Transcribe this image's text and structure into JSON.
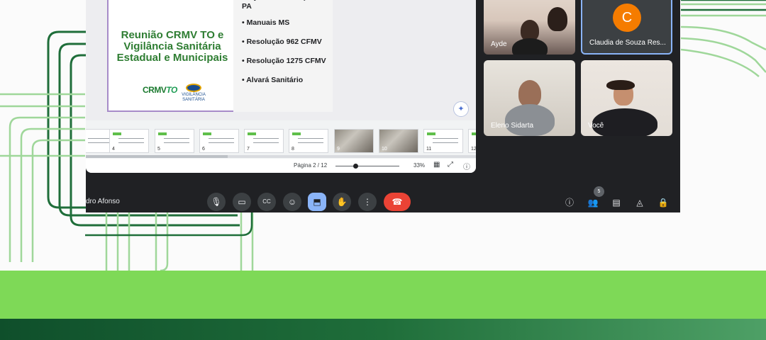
{
  "slide": {
    "title": "Reunião CRMV TO e Vigilância Sanitária Estadual e Municipais",
    "bullets": [
      "Projeto de castração CCZ PA",
      "• Manuais MS",
      "• Resolução 962 CFMV",
      "• Resolução 1275 CFMV",
      "• Alvará Sanitário"
    ],
    "logo_crmv": "CRMV",
    "logo_crmv_suffix": "TO",
    "logo_vigilancia": "VIGILÂNCIA SANITÁRIA"
  },
  "thumbnails": [
    {
      "num": "4"
    },
    {
      "num": "5"
    },
    {
      "num": "6"
    },
    {
      "num": "7"
    },
    {
      "num": "8"
    },
    {
      "num": "9"
    },
    {
      "num": "10"
    },
    {
      "num": "11"
    },
    {
      "num": "12"
    }
  ],
  "presentation_toolbar": {
    "page_indicator": "Página 2 / 12",
    "zoom_percent": "33%",
    "zoom_level": 0.33
  },
  "participants": {
    "ayde": "Ayde",
    "claudia": "Claudia de Souza Res...",
    "claudia_initial": "C",
    "eleno": "Eleno Sidarta",
    "voce": "Você"
  },
  "presenter_name": "dro Afonso",
  "participant_count": "5",
  "icons": {
    "mic": "mic-icon",
    "camera": "camera-icon",
    "captions": "captions-icon",
    "emoji": "emoji-icon",
    "present": "present-screen-icon",
    "hand": "raise-hand-icon",
    "more": "more-options-icon",
    "hangup": "hangup-icon",
    "info": "info-icon",
    "people": "people-icon",
    "chat": "chat-icon",
    "activities": "activities-icon",
    "lock": "host-controls-icon"
  },
  "colors": {
    "meet_bg": "#202124",
    "hangup": "#ea4335",
    "present_active": "#8ab4f8",
    "avatar": "#f57c00",
    "band_light": "#7ed957",
    "band_dark": "#1f6e3a"
  }
}
